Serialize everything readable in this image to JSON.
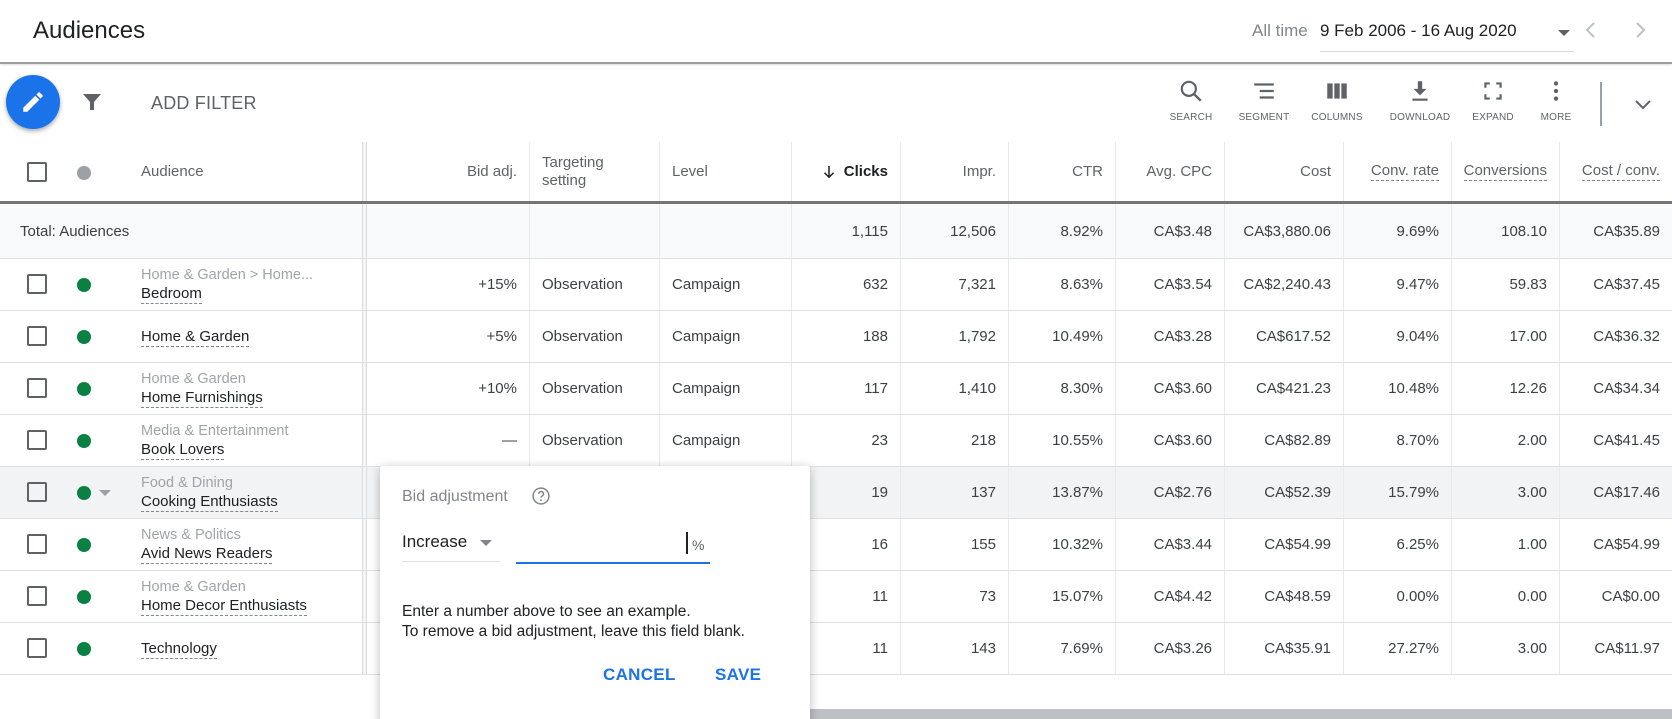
{
  "header": {
    "title": "Audiences",
    "date_range_label": "All time",
    "date_range_value": "9 Feb 2006 - 16 Aug 2020"
  },
  "toolbar": {
    "add_filter_label": "ADD FILTER",
    "tools": [
      {
        "id": "search",
        "label": "SEARCH",
        "icon": "search-icon"
      },
      {
        "id": "segment",
        "label": "SEGMENT",
        "icon": "segment-icon"
      },
      {
        "id": "columns",
        "label": "COLUMNS",
        "icon": "columns-icon"
      },
      {
        "id": "download",
        "label": "DOWNLOAD",
        "icon": "download-icon"
      },
      {
        "id": "expand",
        "label": "EXPAND",
        "icon": "expand-icon"
      },
      {
        "id": "more",
        "label": "MORE",
        "icon": "more-vert-icon"
      }
    ]
  },
  "table": {
    "columns": {
      "audience": "Audience",
      "bid_adj": "Bid adj.",
      "targeting": "Targeting setting",
      "level": "Level",
      "clicks": "Clicks",
      "impr": "Impr.",
      "ctr": "CTR",
      "avg_cpc": "Avg. CPC",
      "cost": "Cost",
      "conv_rate": "Conv. rate",
      "conversions": "Conversions",
      "cost_conv": "Cost / conv."
    },
    "sort_column": "clicks",
    "sort_direction": "descending",
    "total": {
      "label": "Total: Audiences",
      "clicks": "1,115",
      "impr": "12,506",
      "ctr": "8.92%",
      "avg_cpc": "CA$3.48",
      "cost": "CA$3,880.06",
      "conv_rate": "9.69%",
      "conversions": "108.10",
      "cost_conv": "CA$35.89"
    },
    "rows": [
      {
        "category": "Home & Garden > Home...",
        "name": "Bedroom",
        "status": "eligible",
        "bid_adj": "+15%",
        "targeting": "Observation",
        "level": "Campaign",
        "clicks": "632",
        "impr": "7,321",
        "ctr": "8.63%",
        "avg_cpc": "CA$3.54",
        "cost": "CA$2,240.43",
        "conv_rate": "9.47%",
        "conversions": "59.83",
        "cost_conv": "CA$37.45"
      },
      {
        "category": "",
        "name": "Home & Garden",
        "status": "eligible",
        "bid_adj": "+5%",
        "targeting": "Observation",
        "level": "Campaign",
        "clicks": "188",
        "impr": "1,792",
        "ctr": "10.49%",
        "avg_cpc": "CA$3.28",
        "cost": "CA$617.52",
        "conv_rate": "9.04%",
        "conversions": "17.00",
        "cost_conv": "CA$36.32"
      },
      {
        "category": "Home & Garden",
        "name": "Home Furnishings",
        "status": "eligible",
        "bid_adj": "+10%",
        "targeting": "Observation",
        "level": "Campaign",
        "clicks": "117",
        "impr": "1,410",
        "ctr": "8.30%",
        "avg_cpc": "CA$3.60",
        "cost": "CA$421.23",
        "conv_rate": "10.48%",
        "conversions": "12.26",
        "cost_conv": "CA$34.34"
      },
      {
        "category": "Media & Entertainment",
        "name": "Book Lovers",
        "status": "eligible",
        "bid_adj": "—",
        "targeting": "Observation",
        "level": "Campaign",
        "clicks": "23",
        "impr": "218",
        "ctr": "10.55%",
        "avg_cpc": "CA$3.60",
        "cost": "CA$82.89",
        "conv_rate": "8.70%",
        "conversions": "2.00",
        "cost_conv": "CA$41.45"
      },
      {
        "category": "Food & Dining",
        "name": "Cooking Enthusiasts",
        "status": "eligible",
        "bid_adj": "",
        "targeting": "",
        "level": "",
        "clicks": "19",
        "impr": "137",
        "ctr": "13.87%",
        "avg_cpc": "CA$2.76",
        "cost": "CA$52.39",
        "conv_rate": "15.79%",
        "conversions": "3.00",
        "cost_conv": "CA$17.46"
      },
      {
        "category": "News & Politics",
        "name": "Avid News Readers",
        "status": "eligible",
        "bid_adj": "",
        "targeting": "",
        "level": "",
        "clicks": "16",
        "impr": "155",
        "ctr": "10.32%",
        "avg_cpc": "CA$3.44",
        "cost": "CA$54.99",
        "conv_rate": "6.25%",
        "conversions": "1.00",
        "cost_conv": "CA$54.99"
      },
      {
        "category": "Home & Garden",
        "name": "Home Decor Enthusiasts",
        "status": "eligible",
        "bid_adj": "",
        "targeting": "",
        "level": "",
        "clicks": "11",
        "impr": "73",
        "ctr": "15.07%",
        "avg_cpc": "CA$4.42",
        "cost": "CA$48.59",
        "conv_rate": "0.00%",
        "conversions": "0.00",
        "cost_conv": "CA$0.00"
      },
      {
        "category": "",
        "name": "Technology",
        "status": "eligible",
        "bid_adj": "",
        "targeting": "",
        "level": "",
        "clicks": "11",
        "impr": "143",
        "ctr": "7.69%",
        "avg_cpc": "CA$3.26",
        "cost": "CA$35.91",
        "conv_rate": "27.27%",
        "conversions": "3.00",
        "cost_conv": "CA$11.97"
      }
    ]
  },
  "popup": {
    "title": "Bid adjustment",
    "direction_value": "Increase",
    "input_value": "",
    "unit": "%",
    "help_line1": "Enter a number above to see an example.",
    "help_line2": "To remove a bid adjustment, leave this field blank.",
    "cancel_label": "CANCEL",
    "save_label": "SAVE"
  },
  "colors": {
    "accent": "#1a73e8",
    "status_green": "#0b8043",
    "status_grey": "#9aa0a6"
  }
}
